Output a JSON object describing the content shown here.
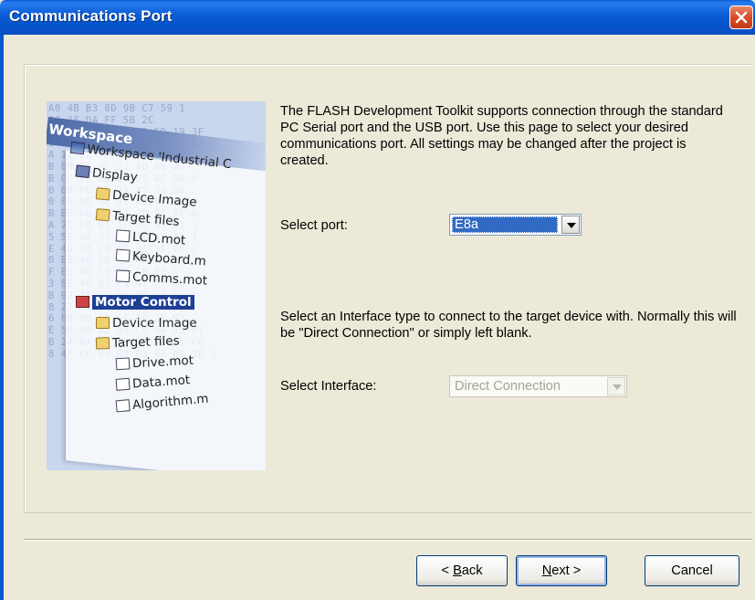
{
  "window": {
    "title": "Communications Port"
  },
  "illustration": {
    "banner": "Workspace",
    "tree": {
      "root": "Workspace 'Industrial C",
      "display": "Display",
      "device_image_1": "Device Image",
      "target_files_1": "Target files",
      "file_lcd": "LCD.mot",
      "file_keyboard": "Keyboard.m",
      "file_comms": "Comms.mot",
      "motor_control": "Motor Control",
      "device_image_2": "Device Image",
      "target_files_2": "Target files",
      "file_drive": "Drive.mot",
      "file_data": "Data.mot",
      "file_algorithm": "Algorithm.m"
    }
  },
  "content": {
    "description": "The FLASH Development Toolkit supports connection through the standard PC Serial port and the USB port. Use this page to select your desired communications port. All settings may be changed after the project is created.",
    "port_label": "Select port:",
    "port_value": "E8a",
    "interface_description": "Select an Interface type to connect to the target device with. Normally this will be \"Direct Connection\" or simply left blank.",
    "interface_label": "Select Interface:",
    "interface_value": "Direct Connection"
  },
  "buttons": {
    "back_prefix": "< ",
    "back_accel": "B",
    "back_rest": "ack",
    "next_accel": "N",
    "next_rest": "ext >",
    "cancel": "Cancel"
  },
  "colors": {
    "titlebar": "#0b5fd8",
    "dialog_bg": "#ece9d8",
    "selection": "#316ac5",
    "close": "#d9502b"
  }
}
